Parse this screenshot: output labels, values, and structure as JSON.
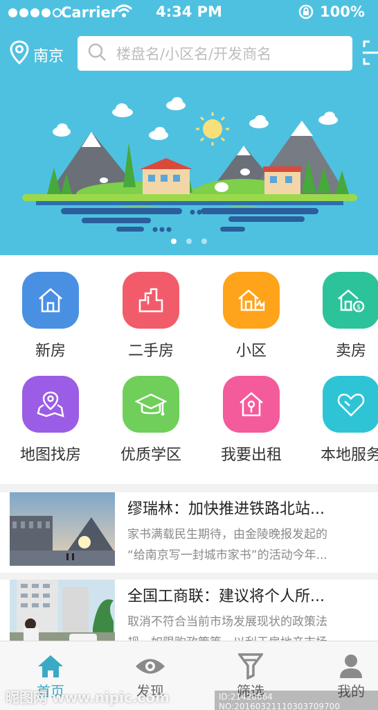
{
  "status": {
    "carrier": "Carrier",
    "time": "4:34 PM",
    "battery": "100%"
  },
  "header": {
    "city": "南京",
    "search_placeholder": "楼盘名/小区名/开发商名"
  },
  "grid": [
    {
      "label": "新房",
      "color": "#4a90e2",
      "icon": "house-icon"
    },
    {
      "label": "二手房",
      "color": "#f25c6a",
      "icon": "second-hand-house-icon"
    },
    {
      "label": "小区",
      "color": "#ffa31a",
      "icon": "community-icon"
    },
    {
      "label": "卖房",
      "color": "#2cc39a",
      "icon": "sell-house-icon"
    },
    {
      "label": "地图找房",
      "color": "#9b5de5",
      "icon": "map-pin-icon"
    },
    {
      "label": "优质学区",
      "color": "#6fcf5a",
      "icon": "graduation-cap-icon"
    },
    {
      "label": "我要出租",
      "color": "#f45b9b",
      "icon": "rent-house-icon"
    },
    {
      "label": "本地服务",
      "color": "#2ec4d6",
      "icon": "heart-icon"
    }
  ],
  "news": [
    {
      "title": "缪瑞林：加快推进铁路北站...",
      "desc1": "家书满载民生期待，由金陵晚报发起的",
      "desc2": "“给南京写一封城市家书”的活动今年..."
    },
    {
      "title": "全国工商联：建议将个人所...",
      "desc1": "取消不符合当前市场发展现状的政策法",
      "desc2": "规，如限购政策等，以利于房地产市场"
    }
  ],
  "tabs": [
    {
      "label": "首页",
      "icon": "home-icon"
    },
    {
      "label": "发现",
      "icon": "eye-icon"
    },
    {
      "label": "筛选",
      "icon": "filter-icon"
    },
    {
      "label": "我的",
      "icon": "user-icon"
    }
  ],
  "watermark": {
    "left": "昵图网 www.nipic.com",
    "right": "ID:21420664 NO:20160321110303709700"
  }
}
